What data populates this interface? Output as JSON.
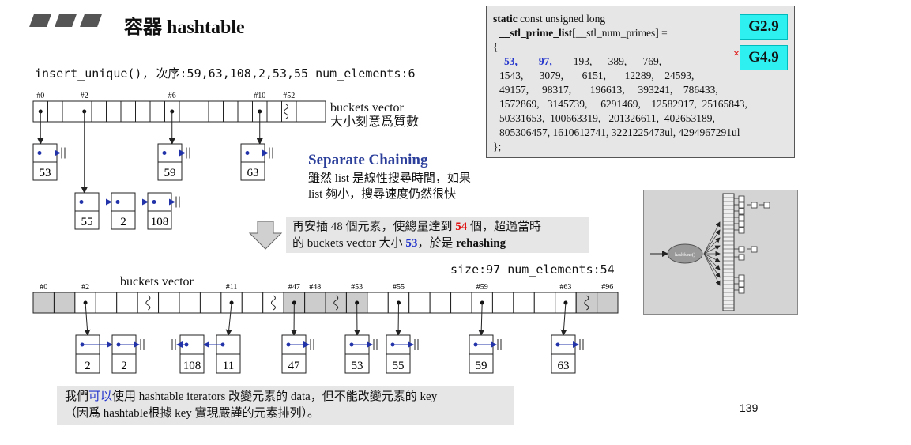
{
  "header": {
    "title": "容器 hashtable"
  },
  "insert_line": "insert_unique(), 次序:59,63,108,2,53,55 num_elements:6",
  "vector1": {
    "label_line1": "buckets vector",
    "label_line2": "大小刻意爲質數",
    "indices": [
      "#0",
      "#2",
      "#6",
      "#10",
      "#52"
    ]
  },
  "chains1": [
    {
      "values": [
        "53"
      ]
    },
    {
      "values": [
        "55",
        "2",
        "108"
      ]
    },
    {
      "values": [
        "59"
      ]
    },
    {
      "values": [
        "63"
      ]
    }
  ],
  "separate_chaining": {
    "title": "Separate Chaining",
    "line1": "雖然 list 是線性搜尋時間，如果",
    "line2": "list 夠小，搜尋速度仍然很快"
  },
  "rehash_note": {
    "line1_a": "再安插 48 個元素，使總量達到 ",
    "line1_num": "54",
    "line1_b": " 個，超過當時",
    "line2_a": "的 buckets vector 大小 ",
    "line2_num": "53",
    "line2_b": "，於是 ",
    "line2_bold": "rehashing"
  },
  "size_line": "size:97  num_elements:54",
  "vector2": {
    "label": "buckets vector",
    "indices": [
      "#0",
      "#2",
      "#11",
      "#47",
      "#48",
      "#53",
      "#55",
      "#59",
      "#63",
      "#96"
    ]
  },
  "chains2": [
    {
      "values": [
        "2",
        "2"
      ]
    },
    {
      "values": [
        "108",
        "11"
      ]
    },
    {
      "values": [
        "47"
      ]
    },
    {
      "values": [
        "53"
      ]
    },
    {
      "values": [
        "55"
      ]
    },
    {
      "values": [
        "59"
      ]
    },
    {
      "values": [
        "63"
      ]
    }
  ],
  "primes": {
    "decl_bold": "static",
    "decl_rest": " const unsigned long",
    "name_bold": "__stl_prime_list",
    "name_rest": "[__stl_num_primes] =",
    "open": "{",
    "first_a": "53,",
    "first_b": "97,",
    "first_rest": "193,      389,      769,",
    "rows": [
      "1543,      3079,       6151,       12289,    24593,",
      "49157,     98317,       196613,     393241,    786433,",
      "1572869,   3145739,     6291469,    12582917,  25165843,",
      "50331653,  100663319,   201326611,  402653189,",
      "805306457, 1610612741, 3221225473ul, 4294967291ul"
    ],
    "close": "};"
  },
  "versions": {
    "g29": "G2.9",
    "g49": "G4.9",
    "mark": "×"
  },
  "bottom_note": {
    "a": "我們",
    "b": "可以",
    "c": "使用 hashtable iterators 改變元素的 data，但不能改變元素的 key",
    "line2": "（因爲 hashtable根據 key 實現嚴謹的元素排列）。"
  },
  "hash_figure": {
    "func_label": "hashfunc()"
  },
  "page_number": "139",
  "colors": {
    "accent_blue": "#2233cc",
    "highlight_red": "#e01010",
    "cyan_badge": "#2ff0f0",
    "panel_gray": "#e6e6e6"
  }
}
